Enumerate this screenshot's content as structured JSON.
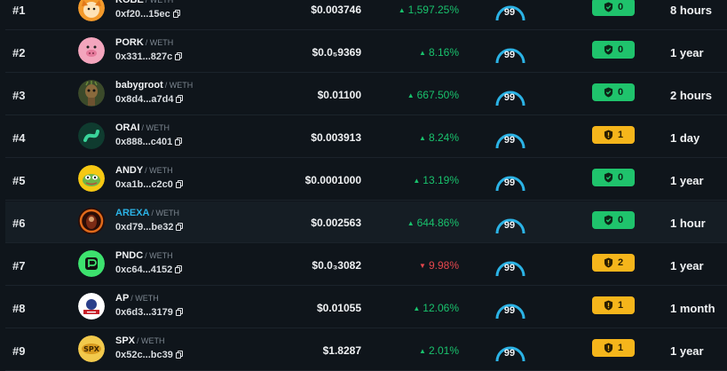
{
  "colors": {
    "background": "#0f151b",
    "up": "#19c26d",
    "down": "#e5474d",
    "badge_safe": "#1fc36c",
    "badge_warn": "#f5b51b",
    "gauge": "#2bb3e6",
    "link": "#2bb3e6"
  },
  "rows": [
    {
      "rank": "#1",
      "symbol": "KOBE",
      "pair": "/ WETH",
      "address": "0xf20...15ec",
      "price": "$0.003746",
      "change": "1,597.25%",
      "direction": "up",
      "score": "99",
      "badge": "0",
      "badge_type": "safe",
      "age": "8 hours",
      "avatar": "kobe-avatar-icon"
    },
    {
      "rank": "#2",
      "symbol": "PORK",
      "pair": "/ WETH",
      "address": "0x331...827c",
      "price": "$0.0₅9369",
      "change": "8.16%",
      "direction": "up",
      "score": "99",
      "badge": "0",
      "badge_type": "safe",
      "age": "1 year",
      "avatar": "pork-avatar-icon"
    },
    {
      "rank": "#3",
      "symbol": "babygroot",
      "pair": "/ WETH",
      "address": "0x8d4...a7d4",
      "price": "$0.01100",
      "change": "667.50%",
      "direction": "up",
      "score": "99",
      "badge": "0",
      "badge_type": "safe",
      "age": "2 hours",
      "avatar": "babygroot-avatar-icon"
    },
    {
      "rank": "#4",
      "symbol": "ORAI",
      "pair": "/ WETH",
      "address": "0x888...c401",
      "price": "$0.003913",
      "change": "8.24%",
      "direction": "up",
      "score": "99",
      "badge": "1",
      "badge_type": "warn",
      "age": "1 day",
      "avatar": "orai-avatar-icon"
    },
    {
      "rank": "#5",
      "symbol": "ANDY",
      "pair": "/ WETH",
      "address": "0xa1b...c2c0",
      "price": "$0.0001000",
      "change": "13.19%",
      "direction": "up",
      "score": "99",
      "badge": "0",
      "badge_type": "safe",
      "age": "1 year",
      "avatar": "andy-avatar-icon"
    },
    {
      "rank": "#6",
      "symbol": "AREXA",
      "pair": "/ WETH",
      "address": "0xd79...be32",
      "price": "$0.002563",
      "change": "644.86%",
      "direction": "up",
      "score": "99",
      "badge": "0",
      "badge_type": "safe",
      "age": "1 hour",
      "avatar": "arexa-avatar-icon"
    },
    {
      "rank": "#7",
      "symbol": "PNDC",
      "pair": "/ WETH",
      "address": "0xc64...4152",
      "price": "$0.0₃3082",
      "change": "9.98%",
      "direction": "down",
      "score": "99",
      "badge": "2",
      "badge_type": "warn",
      "age": "1 year",
      "avatar": "pndc-avatar-icon"
    },
    {
      "rank": "#8",
      "symbol": "AP",
      "pair": "/ WETH",
      "address": "0x6d3...3179",
      "price": "$0.01055",
      "change": "12.06%",
      "direction": "up",
      "score": "99",
      "badge": "1",
      "badge_type": "warn",
      "age": "1 month",
      "avatar": "ap-avatar-icon"
    },
    {
      "rank": "#9",
      "symbol": "SPX",
      "pair": "/ WETH",
      "address": "0x52c...bc39",
      "price": "$1.8287",
      "change": "2.01%",
      "direction": "up",
      "score": "99",
      "badge": "1",
      "badge_type": "warn",
      "age": "1 year",
      "avatar": "spx-avatar-icon"
    }
  ]
}
